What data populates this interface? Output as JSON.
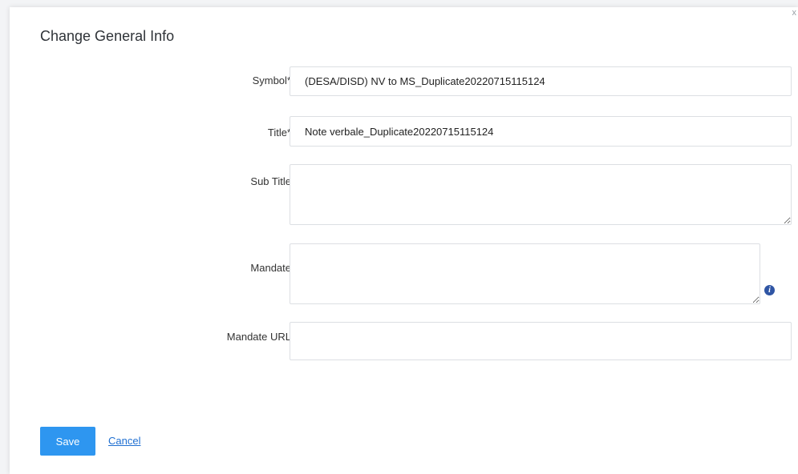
{
  "dialog": {
    "title": "Change General Info",
    "close_glyph": "x"
  },
  "form": {
    "symbol": {
      "label": "Symbol*",
      "value": "(DESA/DISD) NV to MS_Duplicate20220715115124"
    },
    "title": {
      "label": "Title*",
      "value": "Note verbale_Duplicate20220715115124"
    },
    "sub_title": {
      "label": "Sub Title",
      "value": ""
    },
    "mandate": {
      "label": "Mandate",
      "value": "",
      "info_glyph": "i"
    },
    "mandate_url": {
      "label": "Mandate URL",
      "value": ""
    }
  },
  "actions": {
    "save_label": "Save",
    "cancel_label": "Cancel"
  },
  "colors": {
    "primary": "#2e96f0",
    "link": "#1f6fd1",
    "info": "#2f55a4"
  }
}
